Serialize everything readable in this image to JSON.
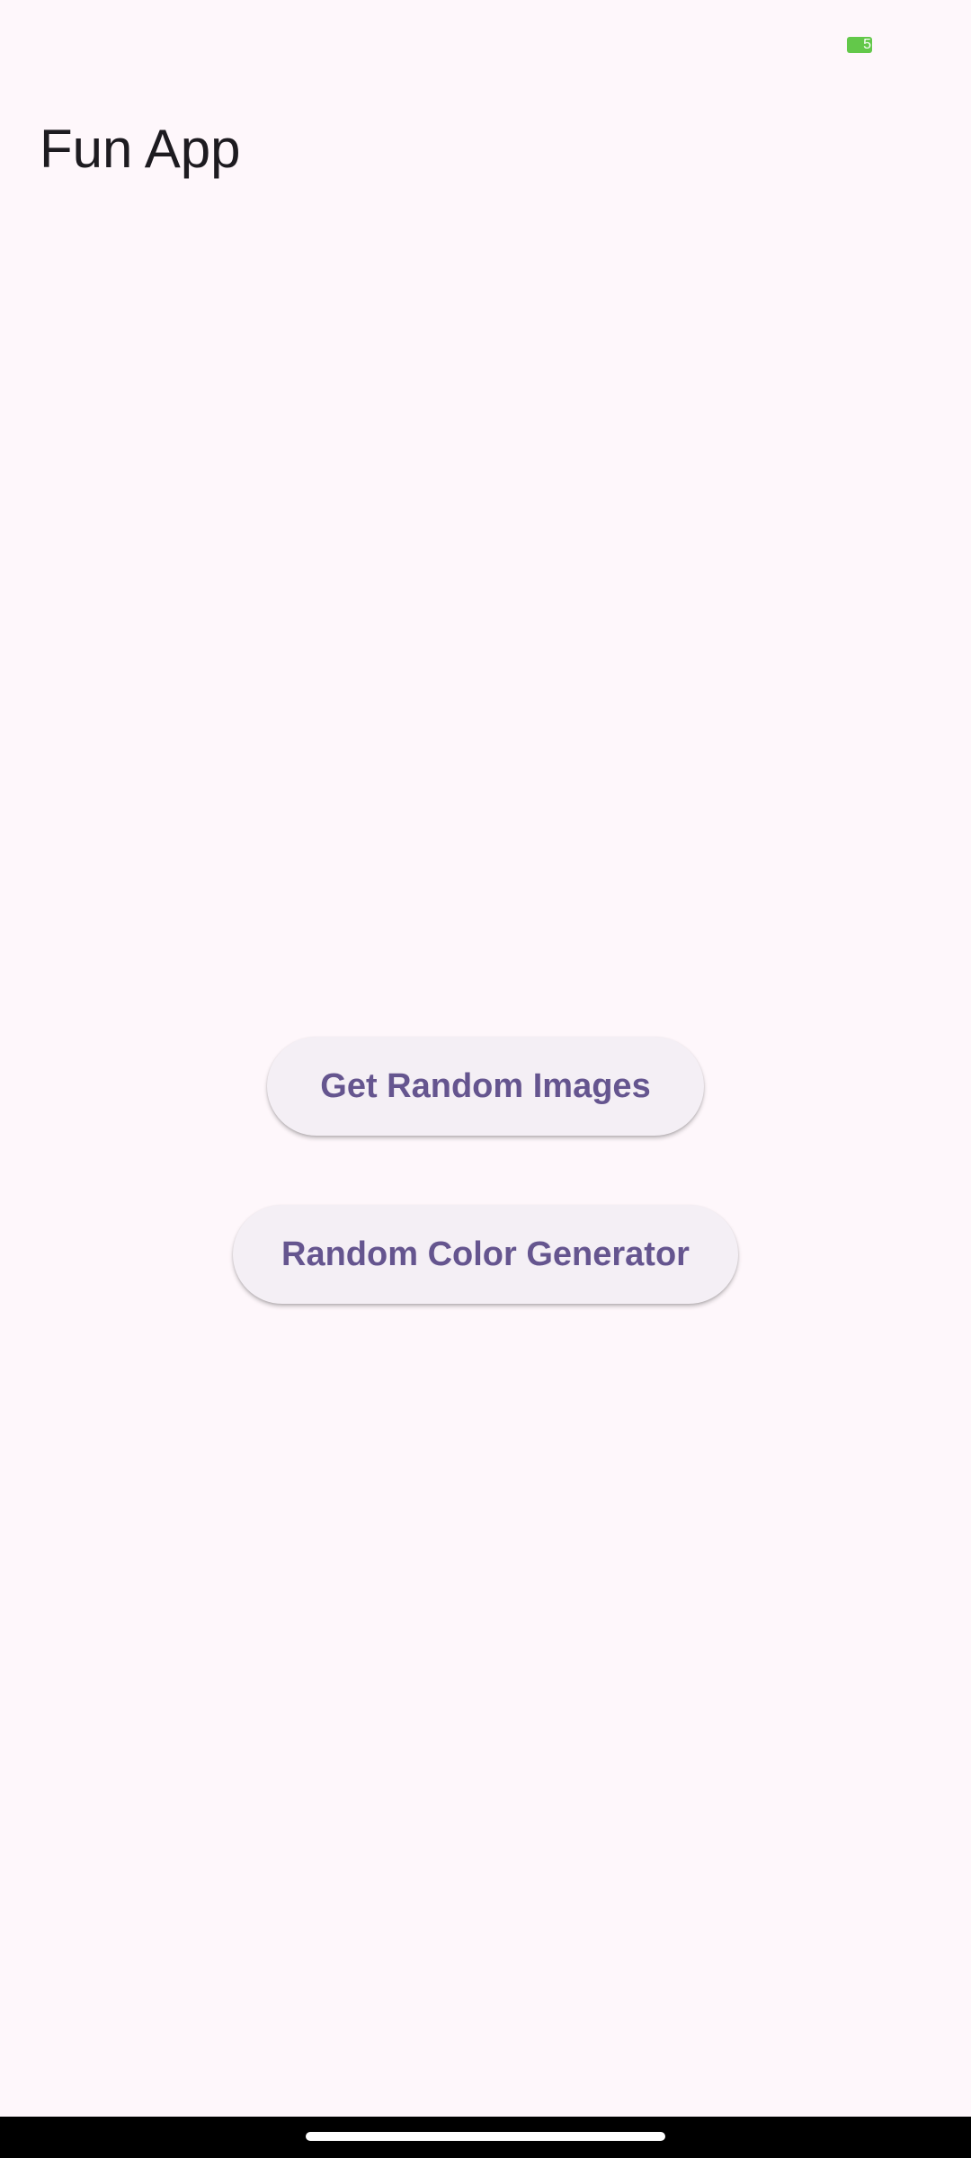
{
  "status_bar": {
    "battery_level": "5"
  },
  "app_bar": {
    "title": "Fun App"
  },
  "main": {
    "buttons": [
      {
        "label": "Get Random Images"
      },
      {
        "label": "Random Color Generator"
      }
    ]
  },
  "colors": {
    "background": "#fef7fb",
    "button_background": "#f4eff5",
    "button_text": "#65558f",
    "title_text": "#1d1b20",
    "battery": "#63c84a",
    "nav_bar": "#000000"
  },
  "icons": {
    "battery": "battery-icon",
    "home_indicator": "home-indicator"
  }
}
